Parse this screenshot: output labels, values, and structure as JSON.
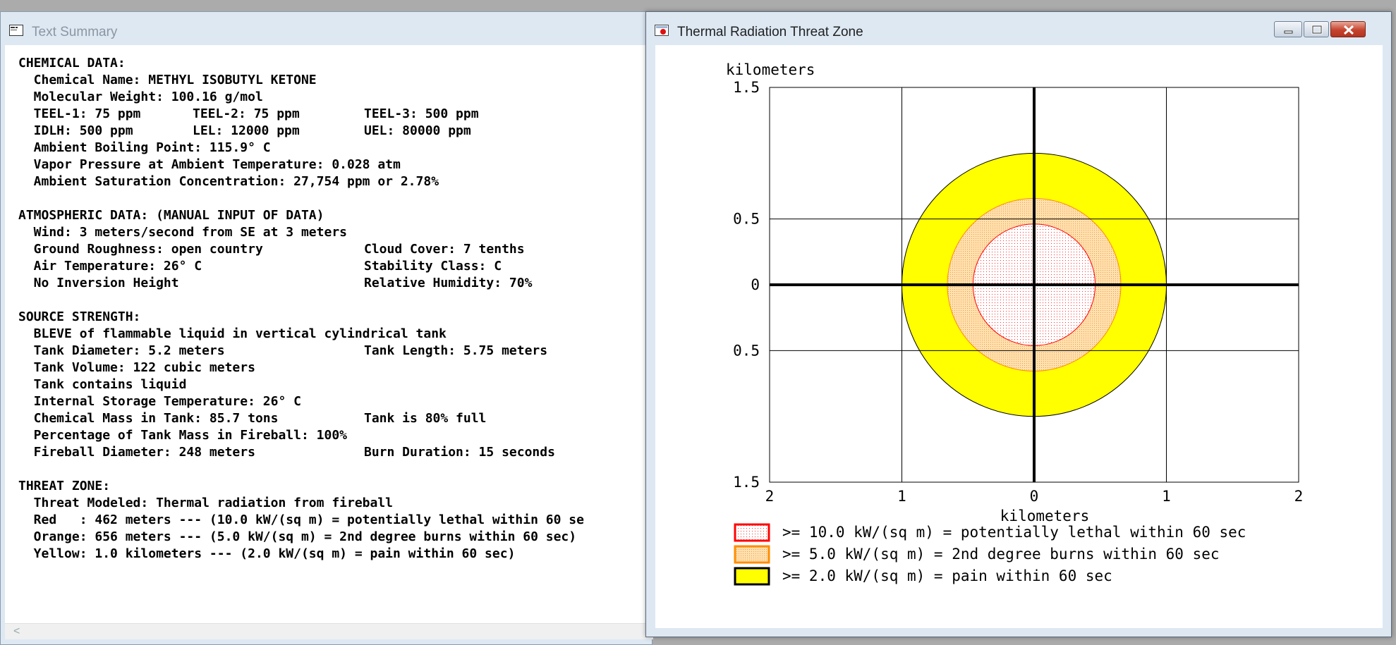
{
  "left_window": {
    "title": "Text Summary",
    "lines": [
      {
        "a": "CHEMICAL DATA:"
      },
      {
        "a": "  Chemical Name: METHYL ISOBUTYL KETONE"
      },
      {
        "a": "  Molecular Weight: 100.16 g/mol"
      },
      {
        "a": "  TEEL-1: 75 ppm",
        "b": "TEEL-2: 75 ppm",
        "c": "TEEL-3: 500 ppm"
      },
      {
        "a": "  IDLH: 500 ppm",
        "b": "LEL: 12000 ppm",
        "c": "UEL: 80000 ppm"
      },
      {
        "a": "  Ambient Boiling Point: 115.9° C"
      },
      {
        "a": "  Vapor Pressure at Ambient Temperature: 0.028 atm"
      },
      {
        "a": "  Ambient Saturation Concentration: 27,754 ppm or 2.78%"
      },
      {
        "a": ""
      },
      {
        "a": "ATMOSPHERIC DATA: (MANUAL INPUT OF DATA)"
      },
      {
        "a": "  Wind: 3 meters/second from SE at 3 meters"
      },
      {
        "a": "  Ground Roughness: open country",
        "c": "Cloud Cover: 7 tenths"
      },
      {
        "a": "  Air Temperature: 26° C",
        "c": "Stability Class: C"
      },
      {
        "a": "  No Inversion Height",
        "c": "Relative Humidity: 70%"
      },
      {
        "a": ""
      },
      {
        "a": "SOURCE STRENGTH:"
      },
      {
        "a": "  BLEVE of flammable liquid in vertical cylindrical tank"
      },
      {
        "a": "  Tank Diameter: 5.2 meters",
        "c": "Tank Length: 5.75 meters"
      },
      {
        "a": "  Tank Volume: 122 cubic meters"
      },
      {
        "a": "  Tank contains liquid"
      },
      {
        "a": "  Internal Storage Temperature: 26° C"
      },
      {
        "a": "  Chemical Mass in Tank: 85.7 tons",
        "c": "Tank is 80% full"
      },
      {
        "a": "  Percentage of Tank Mass in Fireball: 100%"
      },
      {
        "a": "  Fireball Diameter: 248 meters",
        "c": "Burn Duration: 15 seconds"
      },
      {
        "a": ""
      },
      {
        "a": "THREAT ZONE:"
      },
      {
        "a": "  Threat Modeled: Thermal radiation from fireball"
      },
      {
        "a": "  Red   : 462 meters --- (10.0 kW/(sq m) = potentially lethal within 60 se"
      },
      {
        "a": "  Orange: 656 meters --- (5.0 kW/(sq m) = 2nd degree burns within 60 sec)"
      },
      {
        "a": "  Yellow: 1.0 kilometers --- (2.0 kW/(sq m) = pain within 60 sec)"
      }
    ],
    "scroll_left_glyph": "<"
  },
  "right_window": {
    "title": "Thermal Radiation Threat Zone",
    "buttons": {
      "minimize": "minimize",
      "maximize": "maximize",
      "close": "close"
    }
  },
  "chart_data": {
    "type": "area",
    "ylabel_top": "kilometers",
    "xlabel": "kilometers",
    "y_ticks": [
      "1.5",
      "0.5",
      "0",
      "0.5",
      "1.5"
    ],
    "y_tick_values": [
      1.5,
      0.5,
      0,
      -0.5,
      -1.5
    ],
    "x_ticks": [
      "2",
      "1",
      "0",
      "1",
      "2"
    ],
    "x_tick_values": [
      -2,
      -1,
      0,
      1,
      2
    ],
    "xlim": [
      -2,
      2
    ],
    "ylim": [
      -1.5,
      1.5
    ],
    "grid": true,
    "zones": [
      {
        "name": "Red",
        "radius_km": 0.462,
        "fill": "#ffffff",
        "stroke": "#ff0000",
        "legend": ">= 10.0 kW/(sq m) = potentially lethal within 60 sec"
      },
      {
        "name": "Orange",
        "radius_km": 0.656,
        "fill": "#ffd9a8",
        "stroke": "#ff8c00",
        "legend": ">= 5.0 kW/(sq m) = 2nd degree burns within 60 sec"
      },
      {
        "name": "Yellow",
        "radius_km": 1.0,
        "fill": "#ffff00",
        "stroke": "#000000",
        "legend": ">= 2.0 kW/(sq m) = pain within 60 sec"
      }
    ],
    "legend_position": "bottom"
  }
}
